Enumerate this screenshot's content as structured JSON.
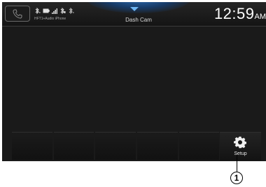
{
  "status_bar": {
    "device_name": "HFT1+Audio iPhone",
    "screen_title": "Dash Cam",
    "clock": {
      "time": "12:59",
      "period": "AM"
    }
  },
  "bottom_bar": {
    "setup_label": "Setup"
  },
  "callout": {
    "number": "1"
  },
  "colors": {
    "screen_bg": "#1a1a1a",
    "accent_blue": "#6fb6f2",
    "text_light": "#ffffff"
  },
  "icons": [
    "phone-icon",
    "bluetooth-icon",
    "battery-icon",
    "signal-icon",
    "chevron-down-icon",
    "gear-icon"
  ]
}
